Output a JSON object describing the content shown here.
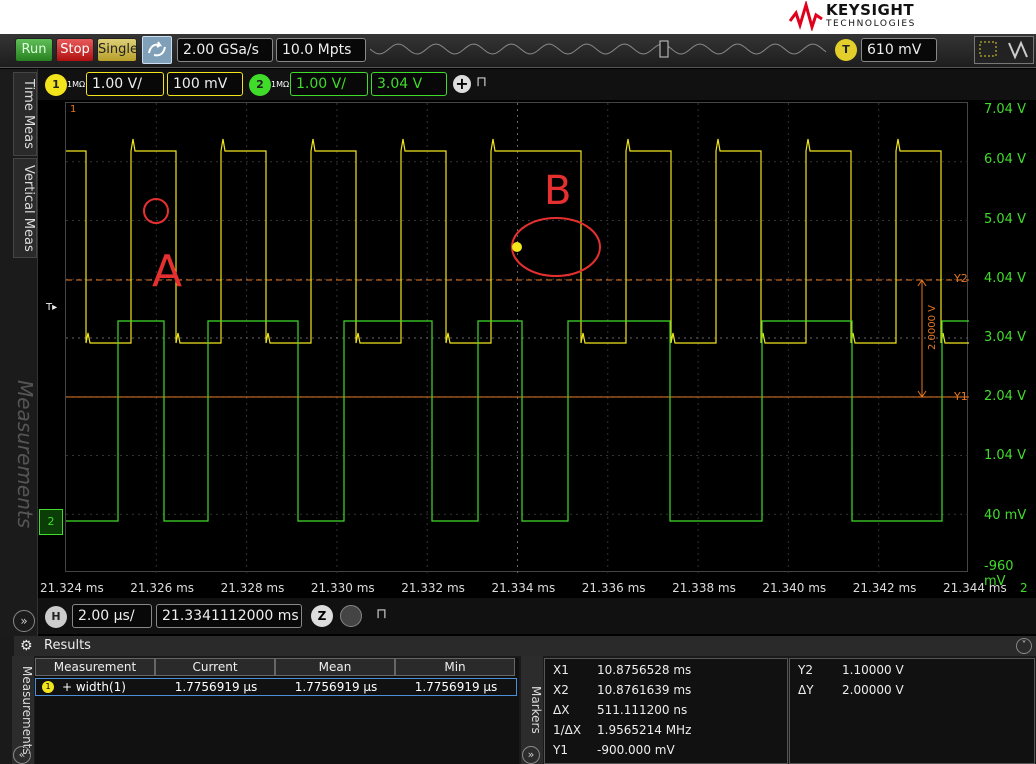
{
  "brand": {
    "name": "KEYSIGHT",
    "sub": "TECHNOLOGIES"
  },
  "toolbar": {
    "run": "Run",
    "stop": "Stop",
    "single": "Single",
    "sample_rate": "2.00 GSa/s",
    "memory": "10.0 Mpts",
    "trigger_label": "T",
    "trigger_level": "610 mV"
  },
  "channels": [
    {
      "num": "1",
      "imp": "1MΩ",
      "scale": "1.00 V/",
      "offset": "100 mV",
      "color": "#f2e51c"
    },
    {
      "num": "2",
      "imp": "1MΩ",
      "scale": "1.00 V/",
      "offset": "3.04 V",
      "color": "#3fdc2a"
    }
  ],
  "side_tabs": {
    "time": "Time Meas",
    "vertical": "Vertical Meas",
    "measurements": "Measurements"
  },
  "grid": {
    "ch1_marker": "1",
    "right_labels": [
      "7.04 V",
      "6.04 V",
      "5.04 V",
      "4.04 V",
      "3.04 V",
      "2.04 V",
      "1.04 V",
      "40 mV",
      "-960 mV"
    ],
    "x_labels": [
      "21.324 ms",
      "21.326 ms",
      "21.328 ms",
      "21.330 ms",
      "21.332 ms",
      "21.334 ms",
      "21.336 ms",
      "21.338 ms",
      "21.340 ms",
      "21.342 ms",
      "21.344 ms"
    ],
    "x_right_marker": "2",
    "y2_label": "Y2",
    "y1_label": "Y1",
    "delta": "2.0000 V",
    "trig_marker": "T",
    "ch2_ground": "2",
    "annotations": {
      "a": "A",
      "b": "B"
    }
  },
  "timebase": {
    "label": "H",
    "scale": "2.00 µs/",
    "position": "21.3341112000 ms"
  },
  "results": {
    "title": "Results",
    "columns": [
      "Measurement",
      "Current",
      "Mean",
      "Min"
    ],
    "rows": [
      {
        "ch": "1",
        "name": "+ width(1)",
        "current": "1.7756919 µs",
        "mean": "1.7756919 µs",
        "min": "1.7756919 µs"
      }
    ],
    "markers_tab": "Markers"
  },
  "markers": {
    "left": [
      [
        "X1",
        "10.8756528 ms"
      ],
      [
        "X2",
        "10.8761639 ms"
      ],
      [
        "ΔX",
        "511.111200 ns"
      ],
      [
        "1/ΔX",
        "1.9565214 MHz"
      ],
      [
        "Y1",
        "-900.000 mV"
      ]
    ],
    "right": [
      [
        "Y2",
        "1.10000 V"
      ],
      [
        "ΔY",
        "2.00000 V"
      ]
    ]
  }
}
